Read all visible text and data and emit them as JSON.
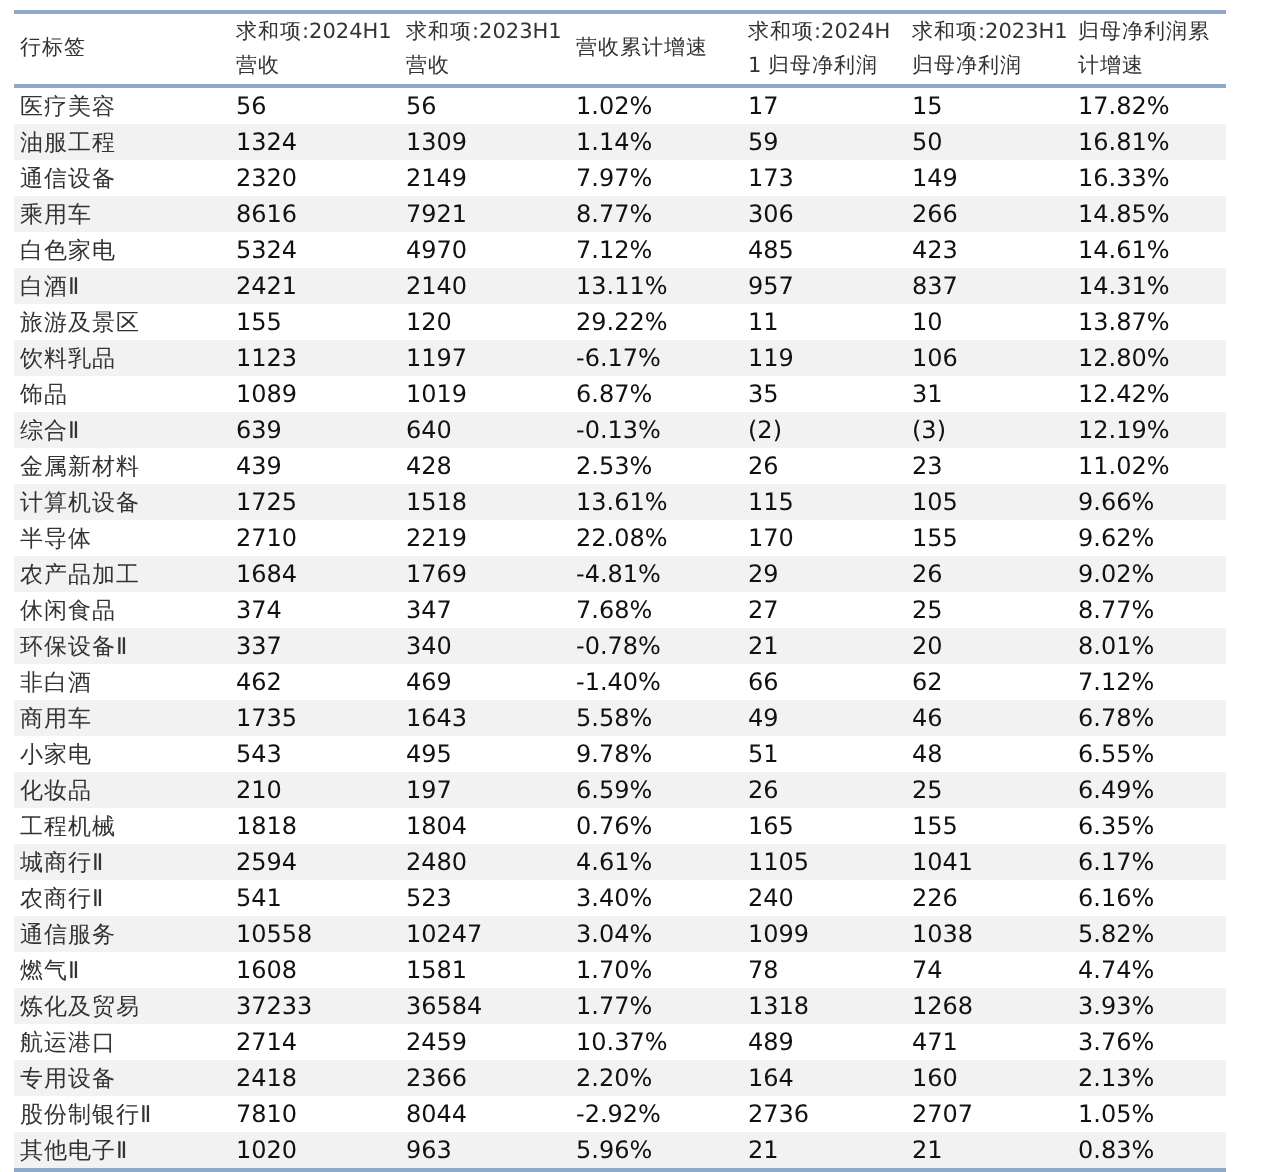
{
  "table": {
    "columns": [
      "行标签",
      "求和项:2024H1 营收",
      "求和项:2023H1 营收",
      "营收累计增速",
      "求和项:2024H1 归母净利润",
      "求和项:2023H1 归母净利润",
      "归母净利润累计增速"
    ],
    "rows": [
      [
        "医疗美容",
        "56",
        "56",
        "1.02%",
        "17",
        "15",
        "17.82%"
      ],
      [
        "油服工程",
        "1324",
        "1309",
        "1.14%",
        "59",
        "50",
        "16.81%"
      ],
      [
        "通信设备",
        "2320",
        "2149",
        "7.97%",
        "173",
        "149",
        "16.33%"
      ],
      [
        "乘用车",
        "8616",
        "7921",
        "8.77%",
        "306",
        "266",
        "14.85%"
      ],
      [
        "白色家电",
        "5324",
        "4970",
        "7.12%",
        "485",
        "423",
        "14.61%"
      ],
      [
        "白酒Ⅱ",
        "2421",
        "2140",
        "13.11%",
        "957",
        "837",
        "14.31%"
      ],
      [
        "旅游及景区",
        "155",
        "120",
        "29.22%",
        "11",
        "10",
        "13.87%"
      ],
      [
        "饮料乳品",
        "1123",
        "1197",
        "-6.17%",
        "119",
        "106",
        "12.80%"
      ],
      [
        "饰品",
        "1089",
        "1019",
        "6.87%",
        "35",
        "31",
        "12.42%"
      ],
      [
        "综合Ⅱ",
        "639",
        "640",
        "-0.13%",
        "(2)",
        "(3)",
        "12.19%"
      ],
      [
        "金属新材料",
        "439",
        "428",
        "2.53%",
        "26",
        "23",
        "11.02%"
      ],
      [
        "计算机设备",
        "1725",
        "1518",
        "13.61%",
        "115",
        "105",
        "9.66%"
      ],
      [
        "半导体",
        "2710",
        "2219",
        "22.08%",
        "170",
        "155",
        "9.62%"
      ],
      [
        "农产品加工",
        "1684",
        "1769",
        "-4.81%",
        "29",
        "26",
        "9.02%"
      ],
      [
        "休闲食品",
        "374",
        "347",
        "7.68%",
        "27",
        "25",
        "8.77%"
      ],
      [
        "环保设备Ⅱ",
        "337",
        "340",
        "-0.78%",
        "21",
        "20",
        "8.01%"
      ],
      [
        "非白酒",
        "462",
        "469",
        "-1.40%",
        "66",
        "62",
        "7.12%"
      ],
      [
        "商用车",
        "1735",
        "1643",
        "5.58%",
        "49",
        "46",
        "6.78%"
      ],
      [
        "小家电",
        "543",
        "495",
        "9.78%",
        "51",
        "48",
        "6.55%"
      ],
      [
        "化妆品",
        "210",
        "197",
        "6.59%",
        "26",
        "25",
        "6.49%"
      ],
      [
        "工程机械",
        "1818",
        "1804",
        "0.76%",
        "165",
        "155",
        "6.35%"
      ],
      [
        "城商行Ⅱ",
        "2594",
        "2480",
        "4.61%",
        "1105",
        "1041",
        "6.17%"
      ],
      [
        "农商行Ⅱ",
        "541",
        "523",
        "3.40%",
        "240",
        "226",
        "6.16%"
      ],
      [
        "通信服务",
        "10558",
        "10247",
        "3.04%",
        "1099",
        "1038",
        "5.82%"
      ],
      [
        "燃气Ⅱ",
        "1608",
        "1581",
        "1.70%",
        "78",
        "74",
        "4.74%"
      ],
      [
        "炼化及贸易",
        "37233",
        "36584",
        "1.77%",
        "1318",
        "1268",
        "3.93%"
      ],
      [
        "航运港口",
        "2714",
        "2459",
        "10.37%",
        "489",
        "471",
        "3.76%"
      ],
      [
        "专用设备",
        "2418",
        "2366",
        "2.20%",
        "164",
        "160",
        "2.13%"
      ],
      [
        "股份制银行Ⅱ",
        "7810",
        "8044",
        "-2.92%",
        "2736",
        "2707",
        "1.05%"
      ],
      [
        "其他电子Ⅱ",
        "1020",
        "963",
        "5.96%",
        "21",
        "21",
        "0.83%"
      ]
    ]
  }
}
